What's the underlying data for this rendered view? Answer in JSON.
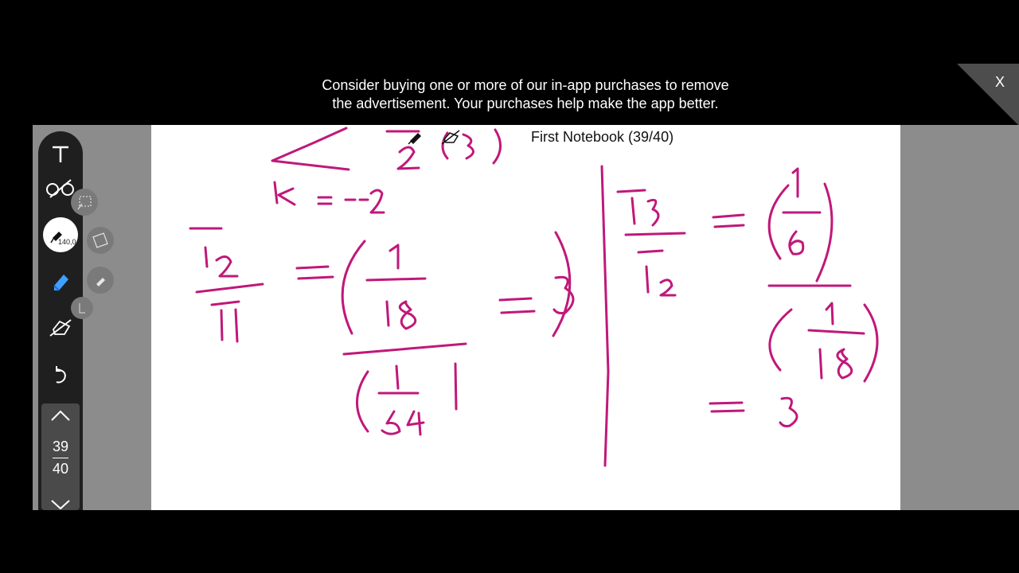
{
  "ad": {
    "line1": "Consider buying one or more of our in-app purchases to remove",
    "line2": "the advertisement. Your purchases help make the app better.",
    "close_label": "X"
  },
  "notebook": {
    "title": "First Notebook (39/40)",
    "current_page": "39",
    "total_pages": "40",
    "pen_size": "140,0",
    "ink_color": "#c0187a"
  },
  "toolbar": {
    "tools": [
      {
        "name": "text-tool",
        "icon": "text-icon"
      },
      {
        "name": "lasso-tool",
        "icon": "lasso-icon"
      },
      {
        "name": "pen-tool",
        "icon": "pen-icon"
      },
      {
        "name": "highlighter-tool",
        "icon": "highlighter-icon"
      },
      {
        "name": "eraser-tool",
        "icon": "eraser-icon"
      },
      {
        "name": "undo-tool",
        "icon": "undo-icon"
      }
    ]
  }
}
